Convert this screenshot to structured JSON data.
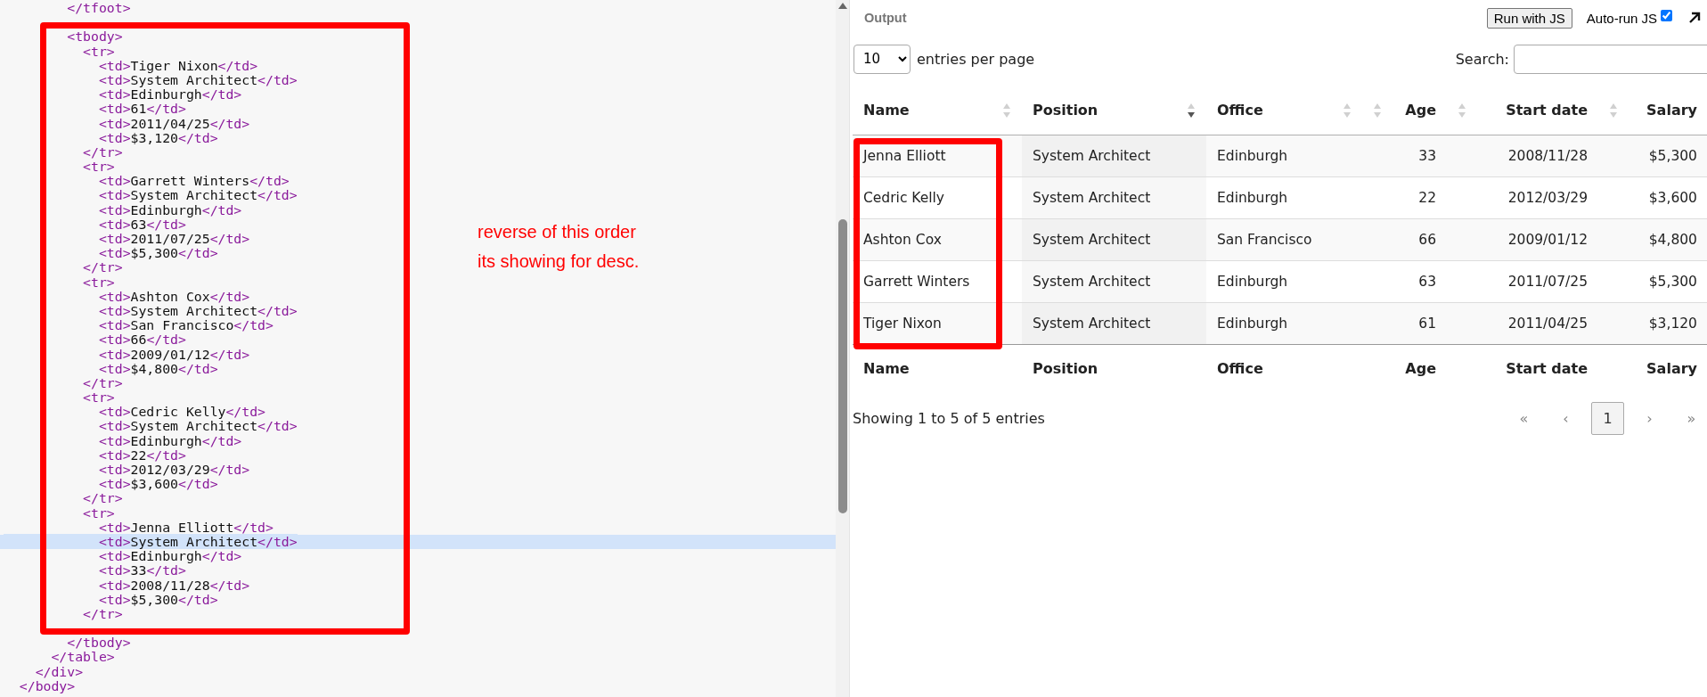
{
  "editor": {
    "lines": [
      {
        "kind": "code",
        "text": "        </tfoot>",
        "current": false
      },
      {
        "kind": "blank"
      },
      {
        "kind": "code",
        "text": "        <tbody>",
        "current": false
      },
      {
        "kind": "code",
        "text": "          <tr>",
        "current": false
      },
      {
        "kind": "code",
        "text": "            <td>Tiger Nixon</td>",
        "current": false
      },
      {
        "kind": "code",
        "text": "            <td>System Architect</td>",
        "current": false
      },
      {
        "kind": "code",
        "text": "            <td>Edinburgh</td>",
        "current": false
      },
      {
        "kind": "code",
        "text": "            <td>61</td>",
        "current": false
      },
      {
        "kind": "code",
        "text": "            <td>2011/04/25</td>",
        "current": false
      },
      {
        "kind": "code",
        "text": "            <td>$3,120</td>",
        "current": false
      },
      {
        "kind": "code",
        "text": "          </tr>",
        "current": false
      },
      {
        "kind": "code",
        "text": "          <tr>",
        "current": false
      },
      {
        "kind": "code",
        "text": "            <td>Garrett Winters</td>",
        "current": false
      },
      {
        "kind": "code",
        "text": "            <td>System Architect</td>",
        "current": false
      },
      {
        "kind": "code",
        "text": "            <td>Edinburgh</td>",
        "current": false
      },
      {
        "kind": "code",
        "text": "            <td>63</td>",
        "current": false
      },
      {
        "kind": "code",
        "text": "            <td>2011/07/25</td>",
        "current": false
      },
      {
        "kind": "code",
        "text": "            <td>$5,300</td>",
        "current": false
      },
      {
        "kind": "code",
        "text": "          </tr>",
        "current": false
      },
      {
        "kind": "code",
        "text": "          <tr>",
        "current": false
      },
      {
        "kind": "code",
        "text": "            <td>Ashton Cox</td>",
        "current": false
      },
      {
        "kind": "code",
        "text": "            <td>System Architect</td>",
        "current": false
      },
      {
        "kind": "code",
        "text": "            <td>San Francisco</td>",
        "current": false
      },
      {
        "kind": "code",
        "text": "            <td>66</td>",
        "current": false
      },
      {
        "kind": "code",
        "text": "            <td>2009/01/12</td>",
        "current": false
      },
      {
        "kind": "code",
        "text": "            <td>$4,800</td>",
        "current": false
      },
      {
        "kind": "code",
        "text": "          </tr>",
        "current": false
      },
      {
        "kind": "code",
        "text": "          <tr>",
        "current": false
      },
      {
        "kind": "code",
        "text": "            <td>Cedric Kelly</td>",
        "current": false
      },
      {
        "kind": "code",
        "text": "            <td>System Architect</td>",
        "current": false
      },
      {
        "kind": "code",
        "text": "            <td>Edinburgh</td>",
        "current": false
      },
      {
        "kind": "code",
        "text": "            <td>22</td>",
        "current": false
      },
      {
        "kind": "code",
        "text": "            <td>2012/03/29</td>",
        "current": false
      },
      {
        "kind": "code",
        "text": "            <td>$3,600</td>",
        "current": false
      },
      {
        "kind": "code",
        "text": "          </tr>",
        "current": false
      },
      {
        "kind": "code",
        "text": "          <tr>",
        "current": false
      },
      {
        "kind": "code",
        "text": "            <td>Jenna Elliott</td>",
        "current": false
      },
      {
        "kind": "code",
        "text": "            <td>System Architect</td>",
        "current": true
      },
      {
        "kind": "code",
        "text": "            <td>Edinburgh</td>",
        "current": false
      },
      {
        "kind": "code",
        "text": "            <td>33</td>",
        "current": false
      },
      {
        "kind": "code",
        "text": "            <td>2008/11/28</td>",
        "current": false
      },
      {
        "kind": "code",
        "text": "            <td>$5,300</td>",
        "current": false
      },
      {
        "kind": "code",
        "text": "          </tr>",
        "current": false
      },
      {
        "kind": "blank"
      },
      {
        "kind": "code",
        "text": "        </tbody>",
        "current": false
      },
      {
        "kind": "code",
        "text": "      </table>",
        "current": false
      },
      {
        "kind": "code",
        "text": "    </div>",
        "current": false
      },
      {
        "kind": "code",
        "text": "  </body>",
        "current": false
      }
    ],
    "note": "reverse of this order\nits showing for desc."
  },
  "output": {
    "title": "Output",
    "run_button": "Run with JS",
    "auto_run": {
      "label": "Auto-run JS",
      "checked": true
    }
  },
  "table": {
    "page_size": "10",
    "page_size_label": "entries per page",
    "search_label": "Search:",
    "columns": [
      {
        "label": "Name",
        "kind": "text",
        "sorted_desc": false
      },
      {
        "label": "Position",
        "kind": "text",
        "sorted_desc": true
      },
      {
        "label": "Office",
        "kind": "text",
        "sorted_desc": false
      },
      {
        "label": "Age",
        "kind": "number",
        "sorted_desc": false
      },
      {
        "label": "Start date",
        "kind": "number",
        "sorted_desc": false
      },
      {
        "label": "Salary",
        "kind": "number",
        "sorted_desc": false
      }
    ],
    "rows": [
      [
        "Jenna Elliott",
        "System Architect",
        "Edinburgh",
        "33",
        "2008/11/28",
        "$5,300"
      ],
      [
        "Cedric Kelly",
        "System Architect",
        "Edinburgh",
        "22",
        "2012/03/29",
        "$3,600"
      ],
      [
        "Ashton Cox",
        "System Architect",
        "San Francisco",
        "66",
        "2009/01/12",
        "$4,800"
      ],
      [
        "Garrett Winters",
        "System Architect",
        "Edinburgh",
        "63",
        "2011/07/25",
        "$5,300"
      ],
      [
        "Tiger Nixon",
        "System Architect",
        "Edinburgh",
        "61",
        "2011/04/25",
        "$3,120"
      ]
    ],
    "footer_columns": [
      "Name",
      "Position",
      "Office",
      "Age",
      "Start date",
      "Salary"
    ],
    "info": "Showing 1 to 5 of 5 entries",
    "pagination": [
      {
        "label": "«",
        "disabled": true,
        "selected": false
      },
      {
        "label": "‹",
        "disabled": true,
        "selected": false
      },
      {
        "label": "1",
        "disabled": false,
        "selected": true
      },
      {
        "label": "›",
        "disabled": true,
        "selected": false
      },
      {
        "label": "»",
        "disabled": true,
        "selected": false
      }
    ]
  }
}
